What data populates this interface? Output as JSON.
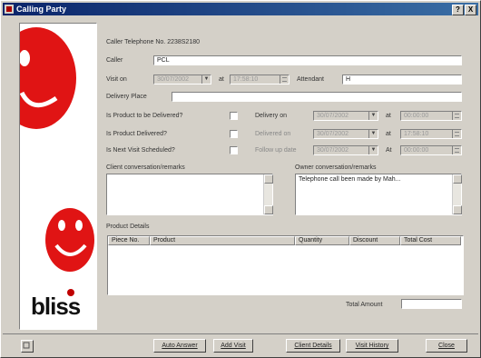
{
  "window": {
    "title": "Calling Party",
    "help_glyph": "?",
    "close_glyph": "X"
  },
  "form": {
    "caller_telephone_label": "Caller Telephone No. 2238S2180",
    "caller_label": "Caller",
    "caller_value": "PCL",
    "visit_on_label": "Visit on",
    "visit_date": "30/07/2002",
    "at_label": "at",
    "visit_time": "17:58:10",
    "attendant_label": "Attendant",
    "attendant_value": "H",
    "delivery_place_label": "Delivery Place",
    "delivery_place_value": "",
    "q_delivered_label": "Is Product to be Delivered?",
    "delivery_on_label": "Delivery on",
    "delivery_date": "30/07/2002",
    "delivery_time": "00:00:00",
    "q_product_delivered_label": "Is Product Delivered?",
    "delivered_on_label": "Delivered on",
    "delivered_date": "30/07/2002",
    "delivered_time": "17:58:10",
    "q_next_visit_label": "Is Next Visit Scheduled?",
    "followup_label": "Follow up date",
    "followup_date": "30/07/2002",
    "at_label_caps": "At",
    "followup_time": "00:00:00",
    "client_conv_label": "Client conversation/remarks",
    "client_conv_value": "",
    "owner_conv_label": "Owner conversation/remarks",
    "owner_conv_value": "Telephone call been made by Mah...",
    "product_details_label": "Product Details",
    "columns": [
      "Piece No.",
      "Product",
      "Quantity",
      "Discount",
      "Total Cost"
    ],
    "total_amount_label": "Total Amount",
    "total_amount_value": ""
  },
  "buttons": {
    "auto_answer": "Auto Answer",
    "add_visit": "Add Visit",
    "client_details": "Client Details",
    "visit_history": "Visit History",
    "close": "Close"
  },
  "brand": {
    "logo_text": "bliss"
  },
  "colors": {
    "titlebar": "#0a246a",
    "smiley_red": "#e01414",
    "accent_red": "#c00000"
  },
  "icons": [
    "app-icon",
    "help-icon",
    "close-icon",
    "smiley-top-icon",
    "smiley-bottom-icon",
    "status-icon"
  ]
}
